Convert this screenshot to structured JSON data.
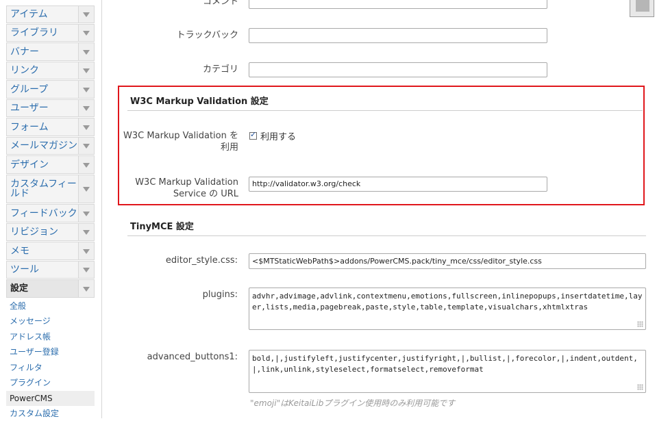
{
  "sidebar": {
    "menu": [
      {
        "label": "アイテム"
      },
      {
        "label": "ライブラリ"
      },
      {
        "label": "バナー"
      },
      {
        "label": "リンク"
      },
      {
        "label": "グループ"
      },
      {
        "label": "ユーザー"
      },
      {
        "label": "フォーム"
      },
      {
        "label": "メールマガジン"
      },
      {
        "label": "デザイン"
      },
      {
        "label": "カスタムフィールド"
      },
      {
        "label": "フィードバック"
      },
      {
        "label": "リビジョン"
      },
      {
        "label": "メモ"
      },
      {
        "label": "ツール"
      },
      {
        "label": "設定"
      }
    ],
    "submenu": [
      {
        "label": "全般"
      },
      {
        "label": "メッセージ"
      },
      {
        "label": "アドレス帳"
      },
      {
        "label": "ユーザー登録"
      },
      {
        "label": "フィルタ"
      },
      {
        "label": "プラグイン"
      },
      {
        "label": "PowerCMS"
      },
      {
        "label": "カスタム設定"
      }
    ]
  },
  "fields": {
    "comment": {
      "label": "コメント",
      "value": ""
    },
    "trackback": {
      "label": "トラックバック",
      "value": ""
    },
    "category": {
      "label": "カテゴリ",
      "value": ""
    }
  },
  "w3c": {
    "heading": "W3C Markup Validation 設定",
    "enable_label_line1": "W3C Markup Validation を",
    "enable_label_line2": "利用",
    "enable_checkbox_label": "利用する",
    "enable_checked": true,
    "service_label_line1": "W3C Markup Validation",
    "service_label_line2": "Service の URL",
    "service_url": "http://validator.w3.org/check"
  },
  "tinymce": {
    "heading": "TinyMCE 設定",
    "editor_style_label": "editor_style.css:",
    "editor_style_value": "<$MTStaticWebPath$>addons/PowerCMS.pack/tiny_mce/css/editor_style.css",
    "plugins_label": "plugins:",
    "plugins_value": "advhr,advimage,advlink,contextmenu,emotions,fullscreen,inlinepopups,insertdatetime,layer,lists,media,pagebreak,paste,style,table,template,visualchars,xhtmlxtras",
    "buttons1_label": "advanced_buttons1:",
    "buttons1_value": "bold,|,justifyleft,justifycenter,justifyright,|,bullist,|,forecolor,|,indent,outdent,|,link,unlink,styleselect,formatselect,removeformat",
    "hint": "\"emoji\"はKeitaiLibプラグイン使用時のみ利用可能です"
  },
  "colors": {
    "link": "#2b6dad",
    "highlight": "#e0161b"
  },
  "icons": {
    "menu_chevron": "chevron-down-icon",
    "corner": "app-icon"
  }
}
